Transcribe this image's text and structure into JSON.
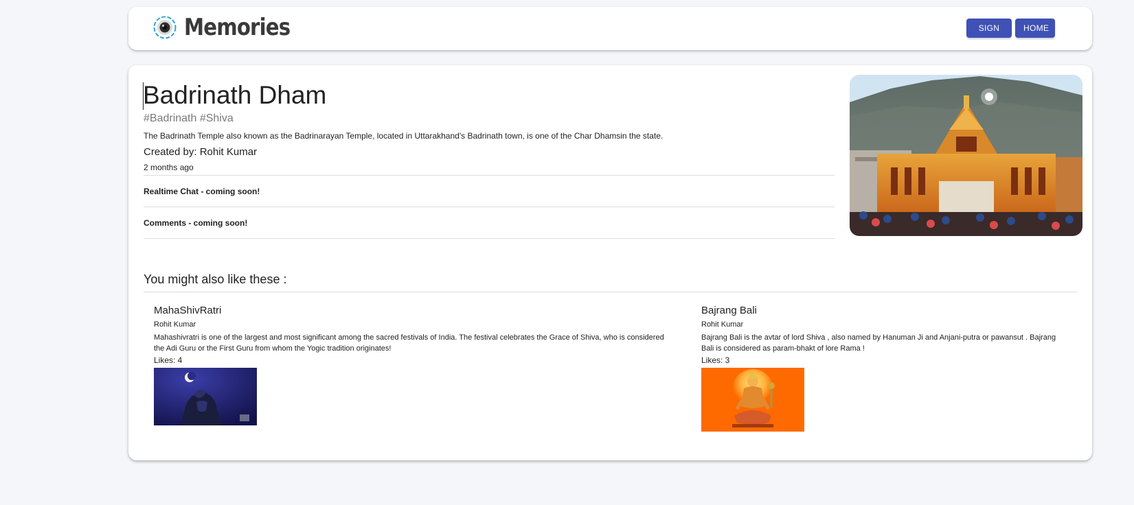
{
  "header": {
    "brand": "Memories",
    "signin_label": "SIGN IN",
    "home_label": "HOME"
  },
  "post": {
    "title": "Badrinath Dham",
    "tags": "#Badrinath #Shiva",
    "description": "The Badrinath Temple also known as the Badrinarayan Temple, located in Uttarakhand's Badrinath town, is one of the Char Dhamsin the state.",
    "created_by": "Created by: Rohit Kumar",
    "time": "2 months ago",
    "chat_label": "Realtime Chat - coming soon!",
    "comments_label": "Comments - coming soon!"
  },
  "recommended": {
    "heading": "You might also like these :",
    "items": [
      {
        "title": "MahaShivRatri",
        "author": "Rohit Kumar",
        "description": "Mahashivratri is one of the largest and most significant among the sacred festivals of India. The festival celebrates the Grace of Shiva, who is considered the Adi Guru or the First Guru from whom the Yogic tradition originates!",
        "likes": "Likes: 4"
      },
      {
        "title": "Bajrang Bali",
        "author": "Rohit Kumar",
        "description": "Bajrang Bali is the avtar of lord Shiva , also named by Hanuman Ji and Anjani-putra or pawansut . Bajrang Bali is considered as param-bhakt of lore Rama !",
        "likes": "Likes: 3"
      }
    ]
  },
  "colors": {
    "accent": "#3f51b5",
    "background": "#f5f6fa"
  }
}
